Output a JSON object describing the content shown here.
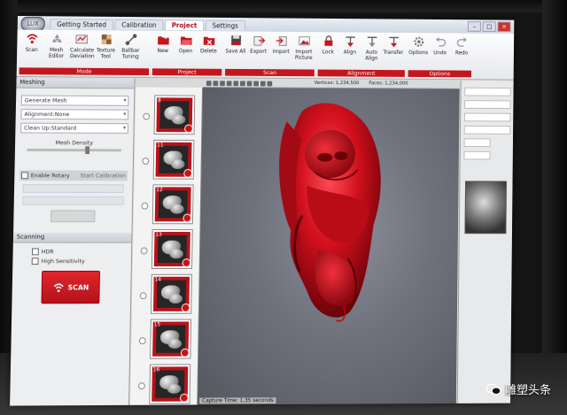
{
  "app": {
    "logo_text": "LUX",
    "tabs": [
      {
        "label": "Getting Started",
        "active": false
      },
      {
        "label": "Calibration",
        "active": false
      },
      {
        "label": "Project",
        "active": true
      },
      {
        "label": "Settings",
        "active": false
      }
    ]
  },
  "ribbon": {
    "mode": {
      "label": "Mode",
      "buttons": [
        {
          "label": "Scan",
          "icon": "wifi-icon"
        },
        {
          "label": "Mesh Editor",
          "icon": "mesh-icon"
        },
        {
          "label": "Calculate Deviation",
          "icon": "deviation-icon"
        },
        {
          "label": "Texture Tool",
          "icon": "texture-icon"
        },
        {
          "label": "Ballbar Tuning",
          "icon": "ballbar-icon"
        }
      ]
    },
    "project": {
      "label": "Project",
      "buttons": [
        {
          "label": "New",
          "icon": "new-folder-icon"
        },
        {
          "label": "Open",
          "icon": "open-folder-icon"
        },
        {
          "label": "Delete",
          "icon": "delete-icon"
        }
      ]
    },
    "scan": {
      "label": "Scan",
      "buttons": [
        {
          "label": "Save All",
          "icon": "save-icon"
        },
        {
          "label": "Export",
          "icon": "export-icon"
        },
        {
          "label": "Import",
          "icon": "import-icon"
        },
        {
          "label": "Import Picture",
          "icon": "picture-icon"
        }
      ]
    },
    "alignment": {
      "label": "Alignment",
      "buttons": [
        {
          "label": "Lock",
          "icon": "lock-icon"
        },
        {
          "label": "Align",
          "icon": "align-icon"
        },
        {
          "label": "Auto Align",
          "icon": "auto-align-icon"
        },
        {
          "label": "Transfer",
          "icon": "transfer-icon"
        }
      ]
    },
    "options": {
      "label": "Options",
      "buttons": [
        {
          "label": "Options",
          "icon": "options-icon"
        },
        {
          "label": "Undo",
          "icon": "undo-icon"
        },
        {
          "label": "Redo",
          "icon": "redo-icon"
        }
      ]
    }
  },
  "left_panel": {
    "title": "Meshing",
    "generate": "Generate Mesh",
    "alignment": "Alignment:None",
    "cleanup": "Clean Up:Standard",
    "density_label": "Mesh Density",
    "density_level": 0.62,
    "enable_rotary": "Enable Rotary",
    "rotary_calibration": "Start Calibration",
    "scanning_title": "Scanning",
    "hdr_label": "HDR",
    "high_sensitivity": "High Sensitivity",
    "scan_button": "SCAN"
  },
  "thumbnails": [
    {
      "num": "8"
    },
    {
      "num": "11"
    },
    {
      "num": "12"
    },
    {
      "num": "13"
    },
    {
      "num": "14"
    },
    {
      "num": "15"
    },
    {
      "num": "16"
    }
  ],
  "viewport": {
    "stats": [
      "Vertices: 1,234,500",
      "Faces: 1,234,000"
    ],
    "footer": "Capture Time: 1.35 seconds"
  },
  "watermark": "雕塑头条"
}
